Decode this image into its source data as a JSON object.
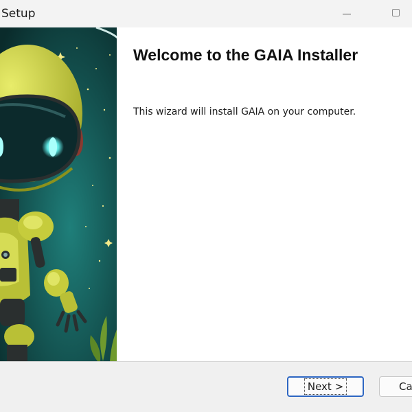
{
  "window": {
    "title": "Setup",
    "controls": {
      "minimize_icon": "minimize-icon",
      "maximize_icon": "maximize-icon"
    }
  },
  "banner": {
    "image_subject": "robot astronaut mascot",
    "colors": {
      "background": "#0f3f3e",
      "robot": "#c9cf3f",
      "visor": "#0b2a2c",
      "eyes": "#6ff4f0"
    }
  },
  "content": {
    "heading": "Welcome to the GAIA Installer",
    "body": "This wizard will install GAIA on your computer."
  },
  "footer": {
    "next_label": "Next >",
    "cancel_label": "Ca"
  },
  "colors": {
    "focus_border": "#2d66c2",
    "footer_bg": "#f0f0f0"
  }
}
